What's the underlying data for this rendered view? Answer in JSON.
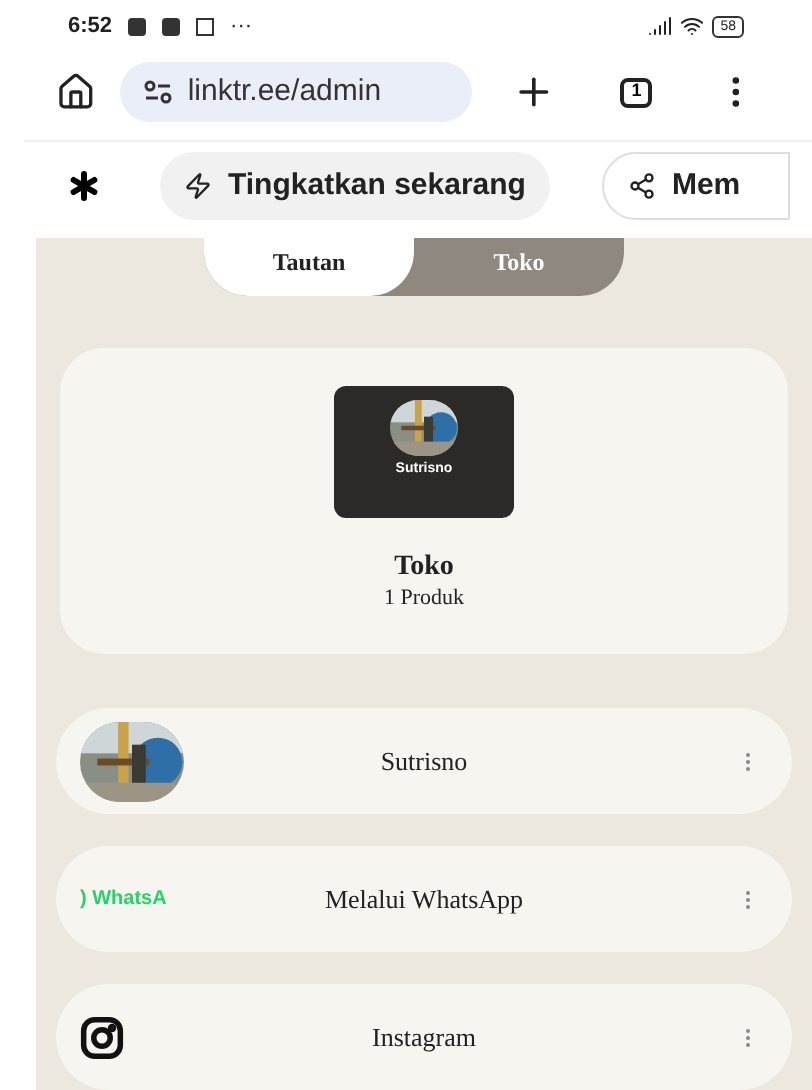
{
  "status_bar": {
    "time": "6:52",
    "more": "···",
    "battery": "58"
  },
  "browser": {
    "url": "linktr.ee/admin",
    "tab_count": "1"
  },
  "toolbar": {
    "upgrade_button": "Tingkatkan sekarang",
    "share_button": "Mem"
  },
  "tabs": [
    {
      "label": "Tautan",
      "selected": true
    },
    {
      "label": "Toko",
      "selected": false
    }
  ],
  "shop_card": {
    "profile_name": "Sutrisno",
    "title": "Toko",
    "subtitle": "1 Produk"
  },
  "links": [
    {
      "title": "Sutrisno"
    },
    {
      "kind": "whatsapp",
      "thumbnail_text": ") WhatsA",
      "title": "Melalui WhatsApp"
    },
    {
      "kind": "instagram",
      "title": "Instagram"
    }
  ]
}
